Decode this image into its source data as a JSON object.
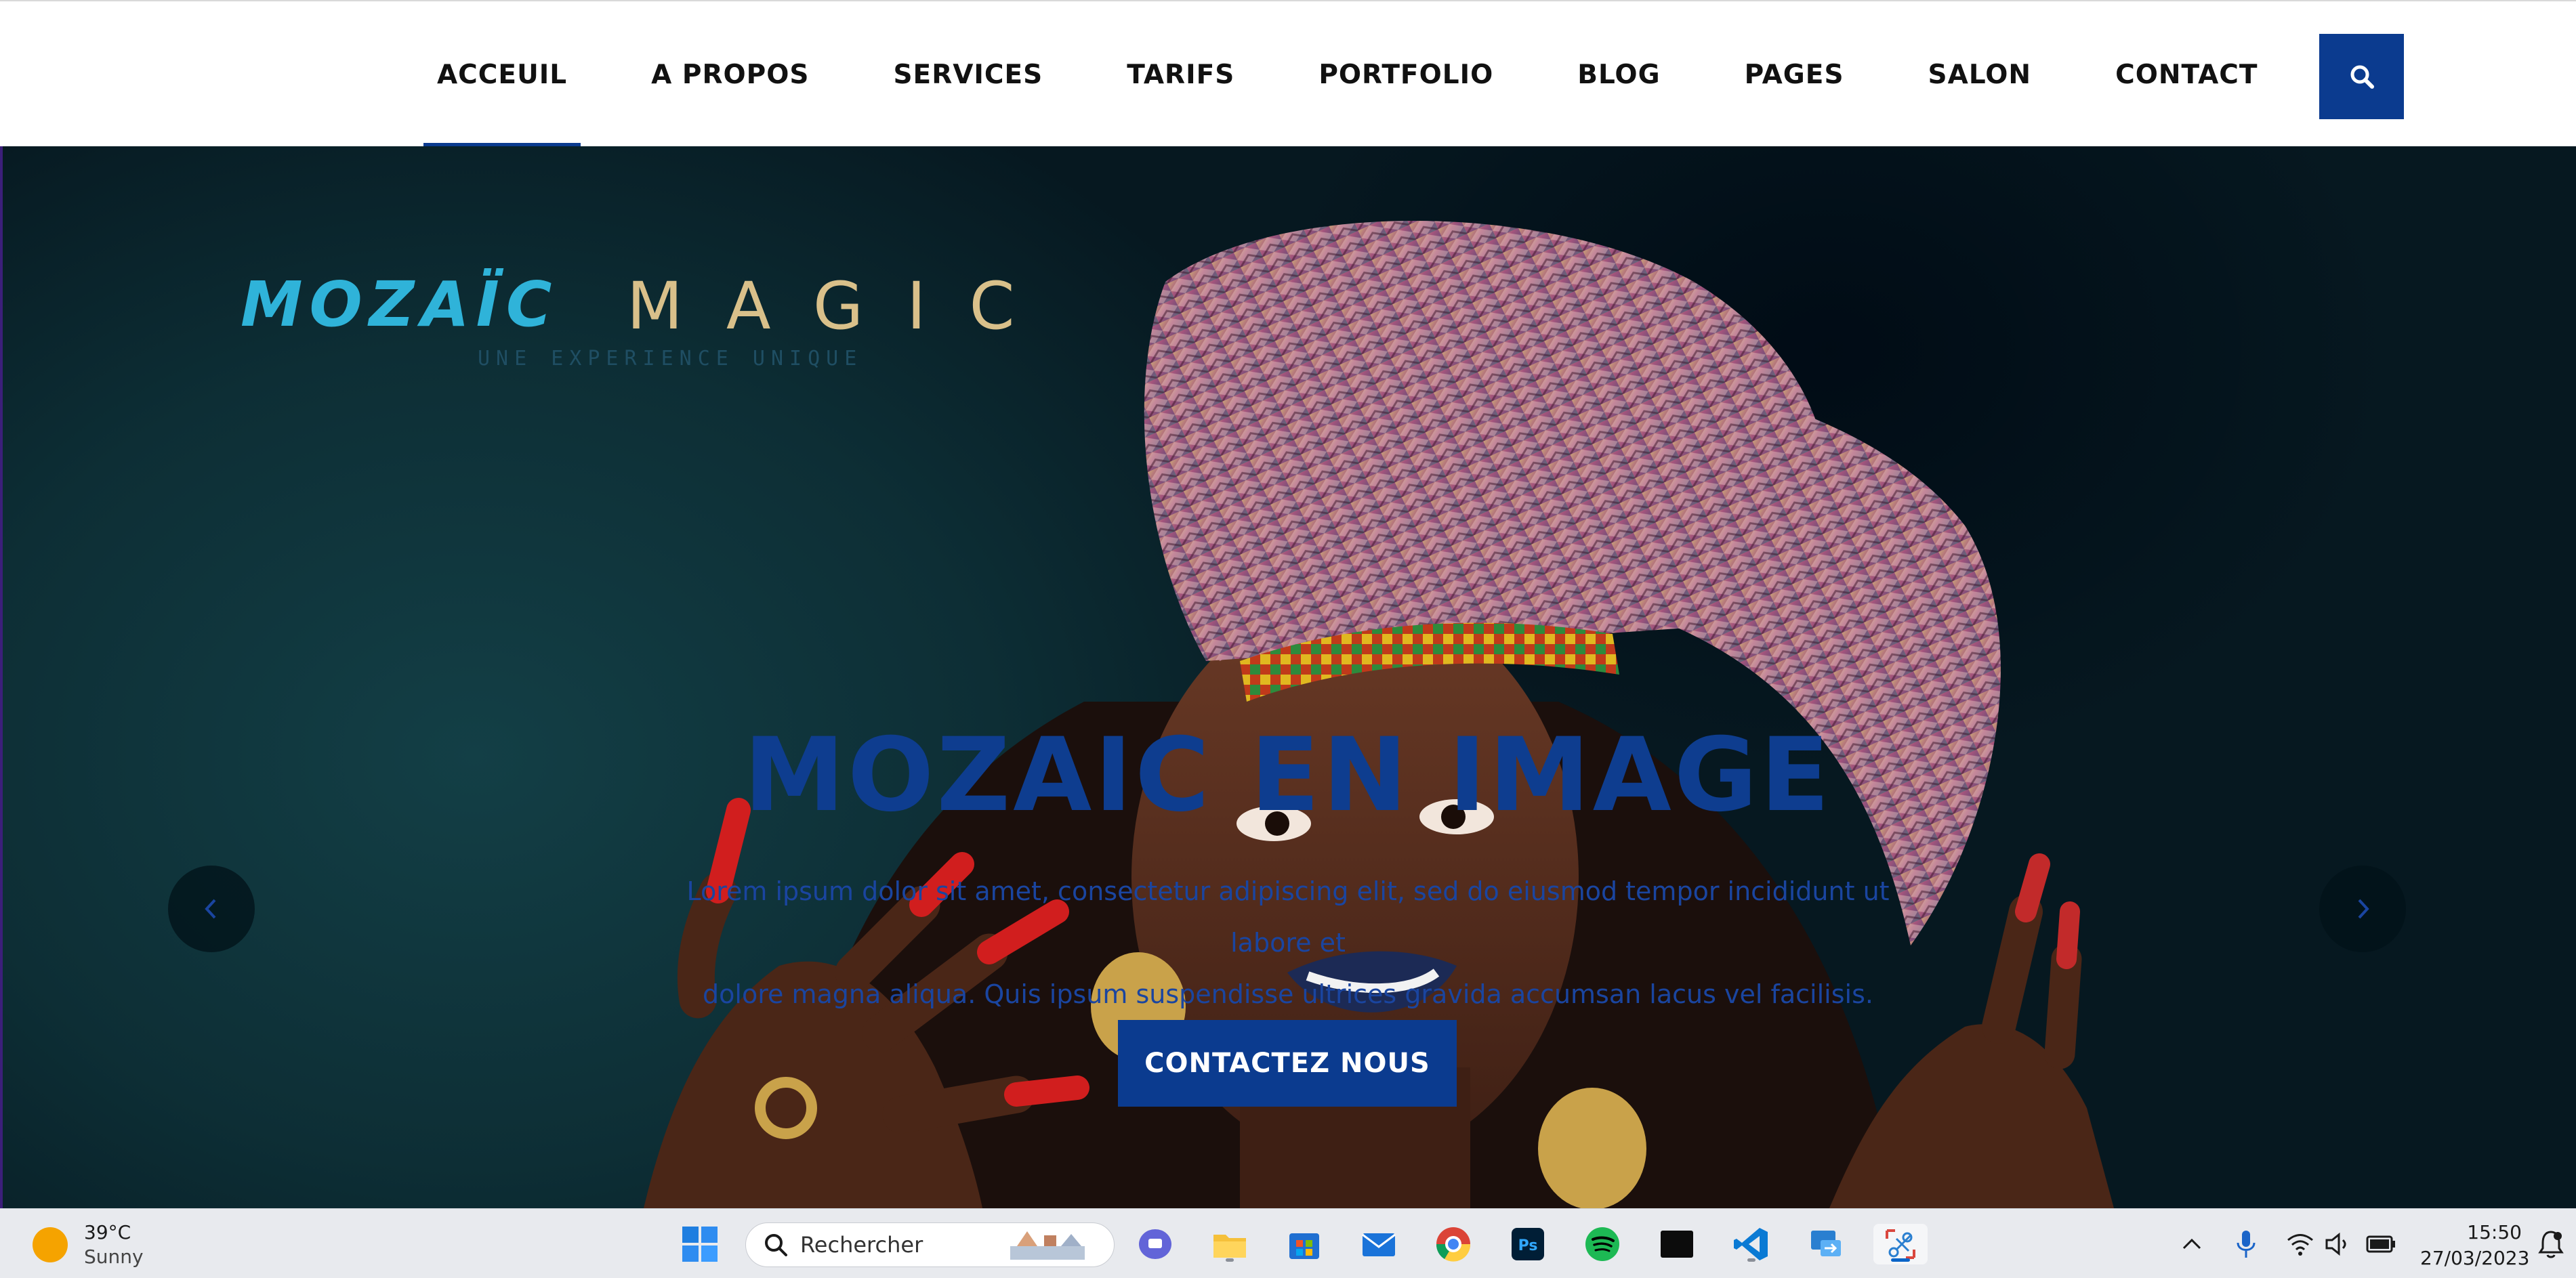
{
  "nav": {
    "items": [
      {
        "label": "ACCEUIL",
        "active": true
      },
      {
        "label": "A PROPOS",
        "active": false
      },
      {
        "label": "SERVICES",
        "active": false
      },
      {
        "label": "TARIFS",
        "active": false
      },
      {
        "label": "PORTFOLIO",
        "active": false
      },
      {
        "label": "BLOG",
        "active": false
      },
      {
        "label": "PAGES",
        "active": false
      },
      {
        "label": "SALON",
        "active": false
      },
      {
        "label": "CONTACT",
        "active": false
      }
    ],
    "search_icon": "search-icon",
    "accent_color": "#0b3b8f"
  },
  "hero": {
    "logo": {
      "part1": "MOZAÏC",
      "part2": "MAGIC",
      "tagline": "UNE EXPERIENCE UNIQUE"
    },
    "title": "MOZAIC EN IMAGE",
    "text_line1": "Lorem ipsum dolor sit amet, consectetur adipiscing elit, sed do eiusmod tempor incididunt ut labore et",
    "text_line2": "dolore magna aliqua. Quis ipsum suspendisse ultrices gravida accumsan lacus vel facilisis.",
    "cta_label": "CONTACTEZ NOUS",
    "prev_icon": "chevron-left-icon",
    "next_icon": "chevron-right-icon"
  },
  "taskbar": {
    "weather": {
      "temp": "39°C",
      "condition": "Sunny"
    },
    "search_placeholder": "Rechercher",
    "apps": [
      "windows-start-icon",
      "teams-chat-icon",
      "file-explorer-icon",
      "store-icon",
      "mail-icon",
      "chrome-icon",
      "photoshop-icon",
      "spotify-icon",
      "terminal-icon",
      "vscode-icon",
      "remote-desktop-icon",
      "snipping-tool-icon"
    ],
    "clock": {
      "time": "15:50",
      "date": "27/03/2023"
    }
  }
}
